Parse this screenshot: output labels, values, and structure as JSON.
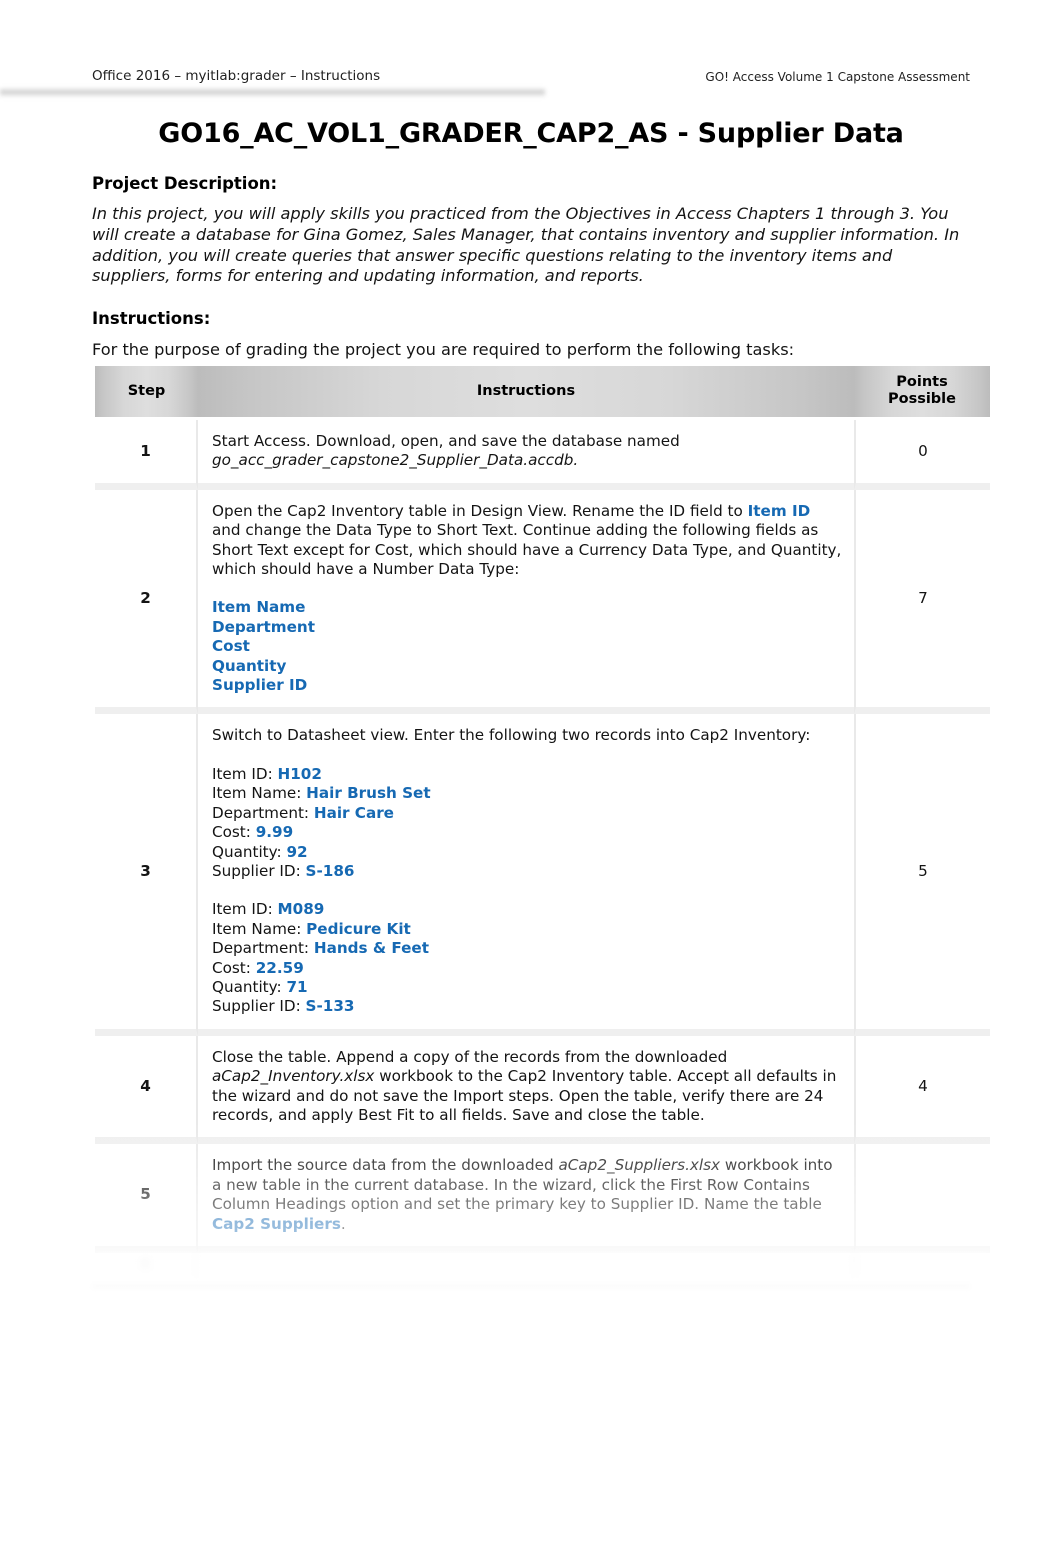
{
  "header": {
    "left": "Office 2016 – myitlab:grader – Instructions",
    "right": "GO! Access Volume 1 Capstone Assessment"
  },
  "title": "GO16_AC_VOL1_GRADER_CAP2_AS - Supplier Data",
  "project_description": {
    "heading": "Project Description:",
    "body": "In this project, you will apply skills you practiced from the Objectives in Access Chapters 1 through 3. You will create a database for Gina Gomez, Sales Manager, that contains inventory and supplier information. In addition, you will create queries that answer specific questions relating to the inventory items and suppliers, forms for entering and updating information, and reports."
  },
  "instructions": {
    "heading": "Instructions:",
    "lead": "For the purpose of grading the project you are required to perform the following tasks:"
  },
  "table": {
    "columns": {
      "step": "Step",
      "instructions": "Instructions",
      "points": "Points\nPossible"
    },
    "points_header_line1": "Points",
    "points_header_line2": "Possible",
    "rows": [
      {
        "step": "1",
        "points": "0",
        "text_plain": "Start Access. Download, open, and save the database named go_acc_grader_capstone2_Supplier_Data.accdb.",
        "seg": {
          "a": "Start Access. Download, open, and save the database named ",
          "b": "go_acc_grader_capstone2_Supplier_Data.accdb",
          "c": "."
        }
      },
      {
        "step": "2",
        "points": "7",
        "seg": {
          "a": "Open the Cap2 Inventory table in Design View. Rename the ID field to ",
          "b": "Item ID",
          "c": " and change the Data Type to Short Text. Continue adding the following fields as Short Text except for Cost, which should have a Currency Data Type, and Quantity, which should have a Number Data Type:",
          "f1": "Item Name",
          "f2": "Department",
          "f3": "Cost",
          "f4": "Quantity",
          "f5": "Supplier ID"
        }
      },
      {
        "step": "3",
        "points": "5",
        "seg": {
          "intro": "Switch to Datasheet view. Enter the following two records into Cap2 Inventory:",
          "r1_l1_label": "Item ID: ",
          "r1_l1_value": "H102",
          "r1_l2_label": "Item Name: ",
          "r1_l2_value": "Hair Brush Set",
          "r1_l3_label": "Department: ",
          "r1_l3_value": "Hair Care",
          "r1_l4_label": "Cost: ",
          "r1_l4_value": "9.99",
          "r1_l5_label": "Quantity: ",
          "r1_l5_value": "92",
          "r1_l6_label": "Supplier ID: ",
          "r1_l6_value": "S-186",
          "r2_l1_label": "Item ID: ",
          "r2_l1_value": "M089",
          "r2_l2_label": "Item Name: ",
          "r2_l2_value": "Pedicure Kit",
          "r2_l3_label": "Department: ",
          "r2_l3_value": "Hands & Feet",
          "r2_l4_label": "Cost: ",
          "r2_l4_value": "22.59",
          "r2_l5_label": "Quantity: ",
          "r2_l5_value": "71",
          "r2_l6_label": "Supplier ID: ",
          "r2_l6_value": "S-133"
        }
      },
      {
        "step": "4",
        "points": "4",
        "seg": {
          "a": "Close the table. Append a copy of the records from the downloaded ",
          "b": "aCap2_Inventory.xlsx",
          "c": " workbook to the Cap2 Inventory table. Accept all defaults in the wizard and do not save the Import steps. Open the table, verify there are 24 records, and apply Best Fit to all fields. Save and close the table."
        }
      },
      {
        "step": "5",
        "points": "",
        "seg": {
          "a": "Import the source data from the downloaded ",
          "b": "aCap2_Suppliers.xlsx",
          "c": " workbook into a new table in the current database. In the wizard, click the First Row Contains Column Headings option and set the primary key to Supplier ID. Name the table ",
          "d": "Cap2 Suppliers",
          "e": "."
        }
      },
      {
        "step": "6",
        "points": "",
        "faded": true,
        "seg": {
          "a": "",
          "b": "",
          "c": ""
        }
      }
    ]
  },
  "footer": {
    "left": "",
    "mid": "",
    "right": ""
  },
  "colors": {
    "accent_blue": "#1669b3",
    "header_gray": "#d7d7d7",
    "text": "#141414",
    "page_background": "#ffffff"
  }
}
